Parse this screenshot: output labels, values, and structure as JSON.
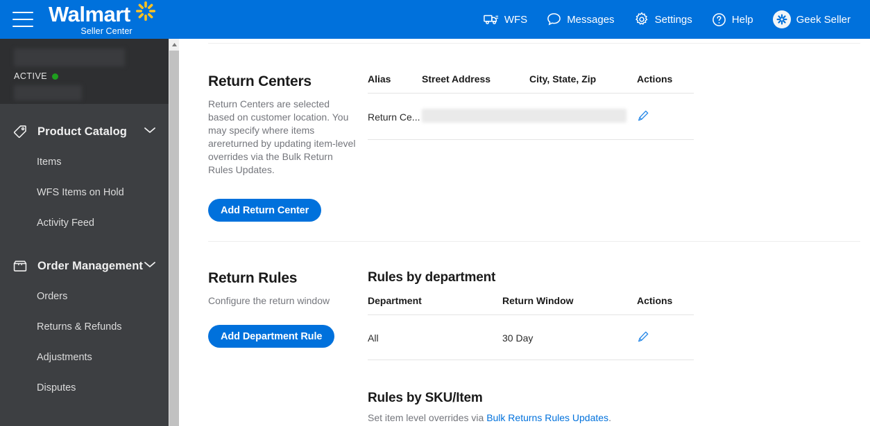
{
  "header": {
    "menu_icon": "hamburger-icon",
    "brand": "Walmart",
    "brand_sub": "Seller Center",
    "nav": [
      {
        "label": "WFS",
        "icon": "truck-icon"
      },
      {
        "label": "Messages",
        "icon": "chat-bubble-icon"
      },
      {
        "label": "Settings",
        "icon": "gear-icon"
      },
      {
        "label": "Help",
        "icon": "question-circle-icon"
      },
      {
        "label": "Geek Seller",
        "icon": "spark-avatar-icon"
      }
    ]
  },
  "sidebar": {
    "status_label": "ACTIVE",
    "status_color": "#1e9e1e",
    "groups": [
      {
        "label": "Product Catalog",
        "icon": "tag-icon",
        "items": [
          "Items",
          "WFS Items on Hold",
          "Activity Feed"
        ]
      },
      {
        "label": "Order Management",
        "icon": "box-icon",
        "items": [
          "Orders",
          "Returns & Refunds",
          "Adjustments",
          "Disputes"
        ]
      }
    ]
  },
  "return_centers": {
    "title": "Return Centers",
    "description": "Return Centers are selected based on customer location. You may specify where items arereturned by updating item-level overrides via the Bulk Return Rules Updates.",
    "button": "Add Return Center",
    "table": {
      "headers": [
        "Alias",
        "Street Address",
        "City, State, Zip",
        "Actions"
      ],
      "rows": [
        {
          "alias": "Return Ce...",
          "street": "",
          "city": "",
          "action": "edit-icon"
        }
      ]
    }
  },
  "return_rules": {
    "title": "Return Rules",
    "description": "Configure the return window",
    "button": "Add Department Rule",
    "dept_table_title": "Rules by department",
    "table": {
      "headers": [
        "Department",
        "Return Window",
        "Actions"
      ],
      "rows": [
        {
          "department": "All",
          "window": "30 Day",
          "action": "edit-icon"
        }
      ]
    },
    "sku_title": "Rules by SKU/Item",
    "sku_desc_prefix": "Set item level overrides via ",
    "sku_link": "Bulk Returns Rules Updates",
    "sku_desc_suffix": "."
  },
  "colors": {
    "brand_blue": "#0071dc",
    "spark_yellow": "#ffc220",
    "sidebar_bg": "#3d3f42",
    "profile_bg": "#2e2f31"
  }
}
